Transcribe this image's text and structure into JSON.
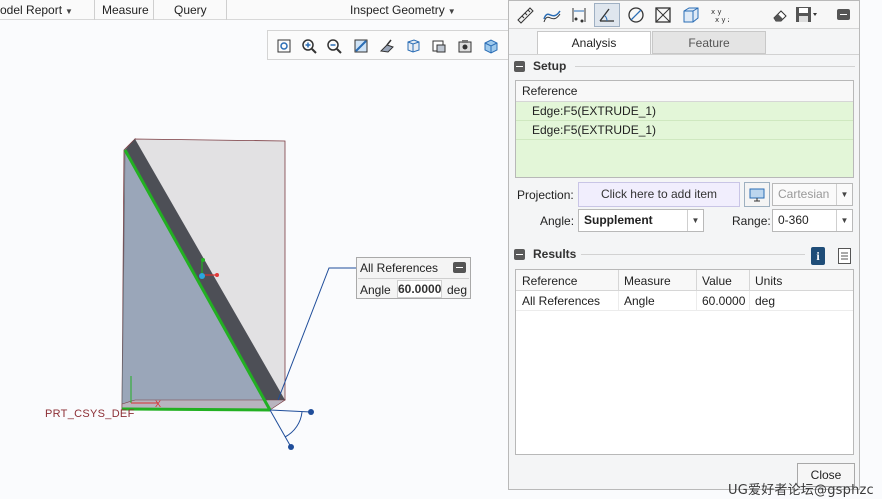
{
  "menubar": {
    "items": [
      {
        "label": "odel Report",
        "has_caret": true
      },
      {
        "label": "Measure",
        "has_caret": false
      },
      {
        "label": "Query",
        "has_caret": false
      },
      {
        "label": "Inspect Geometry",
        "has_caret": true
      }
    ]
  },
  "view_toolbar": {
    "icons": [
      "refit-icon",
      "zoom-in-icon",
      "zoom-out-icon",
      "repaint-icon",
      "orient-icon",
      "saved-views-icon",
      "display-style-icon",
      "view-manager-icon",
      "perspective-icon"
    ]
  },
  "graphics": {
    "csys_label": "PRT_CSYS_DEF",
    "csys_axis_label": "X"
  },
  "callout": {
    "title": "All References",
    "row_label": "Angle",
    "value": "60.0000",
    "unit": "deg"
  },
  "panel": {
    "tools": [
      "length-icon",
      "curve-length-icon",
      "distance-icon",
      "angle-icon",
      "diameter-icon",
      "area-icon",
      "volume-icon",
      "transform-icon"
    ],
    "active_tool": "angle-icon",
    "right_tools": [
      "eraser-icon",
      "save-icon",
      "collapse-icon"
    ],
    "tabs": [
      {
        "label": "Analysis",
        "active": true
      },
      {
        "label": "Feature",
        "active": false
      }
    ],
    "setup": {
      "title": "Setup",
      "ref_header": "Reference",
      "references": [
        "Edge:F5(EXTRUDE_1)",
        "Edge:F5(EXTRUDE_1)"
      ],
      "projection_label": "Projection:",
      "projection_placeholder": "Click here to add item",
      "coord_value": "Cartesian",
      "angle_label": "Angle:",
      "angle_value": "Supplement",
      "range_label": "Range:",
      "range_value": "0-360"
    },
    "results": {
      "title": "Results",
      "columns": [
        "Reference",
        "Measure",
        "Value",
        "Units"
      ],
      "rows": [
        [
          "All References",
          "Angle",
          "60.0000",
          "deg"
        ]
      ]
    },
    "close_label": "Close"
  },
  "watermark": "UG爱好者论坛@gsphzc",
  "colors": {
    "reference_bg": "#e3f6d8",
    "highlight_edge": "#22b022",
    "collector_bg": "#f1eefd",
    "info_blue": "#1f4d78",
    "csys_red": "#8c2f35"
  }
}
